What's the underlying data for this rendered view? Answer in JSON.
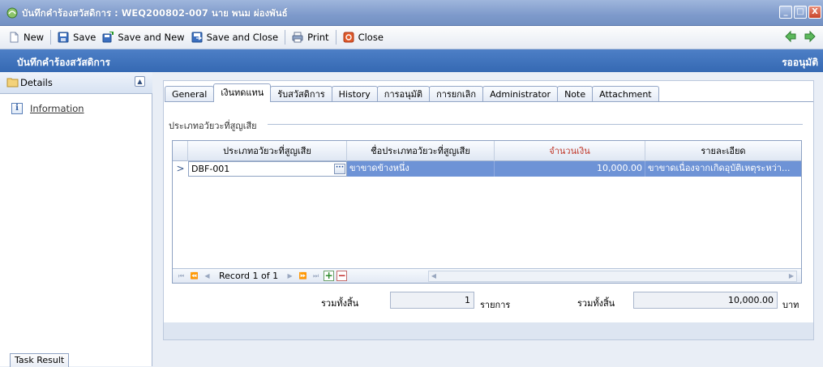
{
  "window": {
    "title": "บันทึกคำร้องสวัสดิการ : WEQ200802-007 นาย พนม ผ่องพันธ์",
    "controls": [
      "_",
      "□",
      "X"
    ]
  },
  "toolbar": {
    "new_label": "New",
    "save_label": "Save",
    "save_new_label": "Save and New",
    "save_close_label": "Save and Close",
    "print_label": "Print",
    "close_label": "Close"
  },
  "header": {
    "title": "บันทึกคำร้องสวัสดิการ",
    "status": "รออนุมัติ"
  },
  "sidebar": {
    "group_label": "Details",
    "items": [
      {
        "label": "Information",
        "icon": "info-icon"
      }
    ],
    "task_result_label": "Task Result"
  },
  "tabs": [
    {
      "label": "General"
    },
    {
      "label": "เงินทดแทน",
      "active": true
    },
    {
      "label": "รับสวัสดิการ"
    },
    {
      "label": "History"
    },
    {
      "label": "การอนุมัติ"
    },
    {
      "label": "การยกเลิก"
    },
    {
      "label": "Administrator"
    },
    {
      "label": "Note"
    },
    {
      "label": "Attachment"
    }
  ],
  "section": {
    "legend": "ประเภทอวัยวะที่สูญเสีย"
  },
  "grid": {
    "columns": [
      "ประเภทอวัยวะที่สูญเสีย",
      "ชื่อประเภทอวัยวะที่สูญเสีย",
      "จำนวนเงิน",
      "รายละเอียด"
    ],
    "rows": [
      {
        "indicator": ">",
        "code": "DBF-001",
        "name": "ขาขาดข้างหนึ่ง",
        "amount": "10,000.00",
        "detail": "ขาขาดเนื่องจากเกิดอุบัติเหตุระหว่า..."
      }
    ],
    "navigator": {
      "record_text": "Record 1 of 1"
    }
  },
  "summary": {
    "count_label": "รวมทั้งสิ้น",
    "count_value": "1",
    "count_unit": "รายการ",
    "total_label": "รวมทั้งสิ้น",
    "total_value": "10,000.00",
    "total_unit": "บาท"
  },
  "colors": {
    "header_band": "#3d72bb",
    "selected_row": "#6e93d6",
    "amount_header": "#c0392b"
  }
}
